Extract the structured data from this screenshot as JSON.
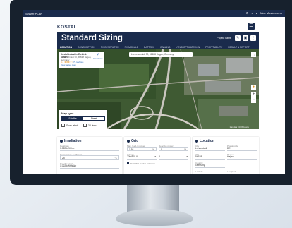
{
  "app": {
    "topbar_label": "SOLAR PLAN",
    "topbar_right": "Max Mustermann",
    "logo": "KOSTAL",
    "title": "Standard Sizing",
    "project_label": "Project name",
    "tabs": [
      "LOCATION",
      "CONSUMPTION",
      "PV GENERATOR",
      "PV MODULE",
      "BATTERY",
      "CABLING",
      "YIELD OPTIMIZATION",
      "PROFITABILITY",
      "RESULT & REPORT"
    ]
  },
  "map": {
    "search_value": "Lenneschmidt 30, 58638 Hagen, Germany",
    "place": {
      "name": "Kostal Industrie Elektrik GmbH",
      "address": "Lenneschmidt 30, 58638 Hagen, Germany",
      "rating": "4.4 ★★★★☆",
      "reviews": "76 reviews",
      "larger_map": "View larger map",
      "directions": "Directions"
    },
    "map_type": {
      "label": "Map type",
      "satellite": "Satellite",
      "street": "Street",
      "selected": "Satellite",
      "check1": "Show labels",
      "check2": "3D view"
    },
    "attribution": "Map data ©2023 Google"
  },
  "panels": {
    "irradiation": {
      "title": "Irradiation",
      "source_label": "Database",
      "source_value": "1.022 kWh/m²",
      "temp_label": "Temperature coefficient",
      "temp_value": "25",
      "temp_unit": "°C",
      "yield_label": "Specific yield",
      "yield_value": "1.022 kWh/kWp"
    },
    "grid": {
      "title": "Grid",
      "p1_label": "Max. feed-in power",
      "p1_value": "1.94",
      "p1_unit": "%",
      "p2_label": "Reactive power",
      "p2_value": "0",
      "p2_unit": "%",
      "voltage_label": "Voltage",
      "voltage_value": "230/400 V",
      "phase_value": "3",
      "note": "Consider feed-in limitation"
    },
    "location": {
      "title": "Location",
      "city_label": "City",
      "city_value": "Lennestadt",
      "code_label": "Postal code",
      "code_value": "DE",
      "zip_label": "ZIP",
      "zip_value": "58638",
      "region_label": "Region",
      "region_value": "Hagen",
      "country_label": "Country",
      "country_value": "Germany",
      "lat_label": "Latitude",
      "lon_label": "Longitude"
    }
  }
}
